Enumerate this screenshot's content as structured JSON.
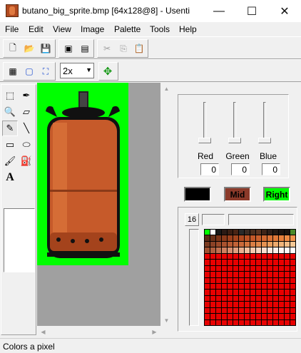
{
  "window": {
    "title": "butano_big_sprite.bmp [64x128@8] - Usenti",
    "minimize_glyph": "—",
    "maximize_glyph": "☐",
    "close_glyph": "✕"
  },
  "menu": [
    "File",
    "Edit",
    "View",
    "Image",
    "Palette",
    "Tools",
    "Help"
  ],
  "toolbar1": {
    "buttons": [
      {
        "name": "new-icon",
        "glyph": "🗋"
      },
      {
        "name": "open-icon",
        "glyph": "📂"
      },
      {
        "name": "save-icon",
        "glyph": "💾"
      },
      {
        "name": "save-all-icon",
        "glyph": "▣"
      },
      {
        "name": "export-icon",
        "glyph": "▤"
      },
      {
        "name": "cut-icon",
        "glyph": "✂"
      },
      {
        "name": "copy-icon",
        "glyph": "⎘"
      },
      {
        "name": "paste-icon",
        "glyph": "📋"
      }
    ]
  },
  "toolbar2": {
    "zoom_value": "2x",
    "buttons": [
      {
        "name": "grid-icon",
        "glyph": "▦"
      },
      {
        "name": "tile-grid-icon",
        "glyph": "▢"
      },
      {
        "name": "fit-icon",
        "glyph": "⛶"
      },
      {
        "name": "move-icon",
        "glyph": "✥"
      }
    ]
  },
  "tools": [
    {
      "name": "select-rect-icon",
      "glyph": "⬚"
    },
    {
      "name": "eyedropper-icon",
      "glyph": "✒"
    },
    {
      "name": "zoom-icon",
      "glyph": "🔍"
    },
    {
      "name": "eraser-icon",
      "glyph": "▱"
    },
    {
      "name": "pencil-icon",
      "glyph": "✎",
      "active": true
    },
    {
      "name": "line-icon",
      "glyph": "╲"
    },
    {
      "name": "rectangle-icon",
      "glyph": "▭"
    },
    {
      "name": "ellipse-icon",
      "glyph": "⬭"
    },
    {
      "name": "brush-icon",
      "glyph": "🖌"
    },
    {
      "name": "fill-icon",
      "glyph": "⛽"
    },
    {
      "name": "text-icon",
      "glyph": "A"
    }
  ],
  "rgb": {
    "labels": [
      "Red",
      "Green",
      "Blue"
    ],
    "values": [
      "0",
      "0",
      "0"
    ]
  },
  "colors": {
    "left_label": "",
    "mid_label": "Mid",
    "right_label": "Right",
    "left_color": "#000000",
    "mid_color": "#8b3a2a",
    "right_color": "#00ff00"
  },
  "palette": {
    "count_label": "16"
  },
  "status": {
    "text": "Colors a pixel"
  }
}
